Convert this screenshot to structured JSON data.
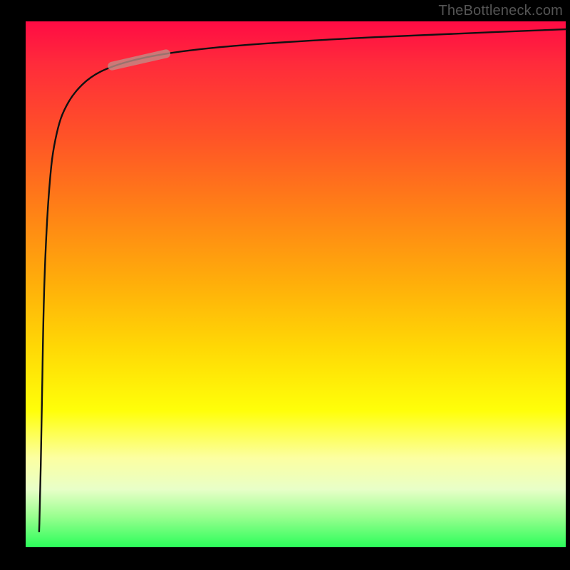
{
  "watermark": "TheBottleneck.com",
  "colors": {
    "frame": "#000000",
    "curve": "#111111",
    "segment_highlight": "#c08e88",
    "watermark_text": "#555555"
  },
  "chart_data": {
    "type": "line",
    "title": "",
    "xlabel": "",
    "ylabel": "",
    "xlim": [
      0,
      100
    ],
    "ylim": [
      0,
      100
    ],
    "grid": false,
    "legend": false,
    "annotations": [],
    "series": [
      {
        "name": "curve",
        "x": [
          2.5,
          2.6,
          3.0,
          3.2,
          3.5,
          4.0,
          4.5,
          5.0,
          6.0,
          7.0,
          9.0,
          12.0,
          16.0,
          22.0,
          30.0,
          40.0,
          55.0,
          75.0,
          100.0
        ],
        "y": [
          3.0,
          6.0,
          25.0,
          40.0,
          52.0,
          63.0,
          70.0,
          75.0,
          80.0,
          83.0,
          86.5,
          89.5,
          91.5,
          93.2,
          94.5,
          95.5,
          96.5,
          97.5,
          98.5
        ]
      }
    ],
    "highlight_segment": {
      "series": "curve",
      "x_range": [
        16,
        26
      ],
      "y_range": [
        86,
        89
      ],
      "stroke_width_relative": 3.5
    },
    "background_gradient": {
      "direction": "vertical",
      "stops": [
        {
          "pos": 0.0,
          "color": "#ff0b44"
        },
        {
          "pos": 0.5,
          "color": "#ffaf0a"
        },
        {
          "pos": 0.74,
          "color": "#ffff09"
        },
        {
          "pos": 1.0,
          "color": "#2bfd5a"
        }
      ]
    }
  }
}
